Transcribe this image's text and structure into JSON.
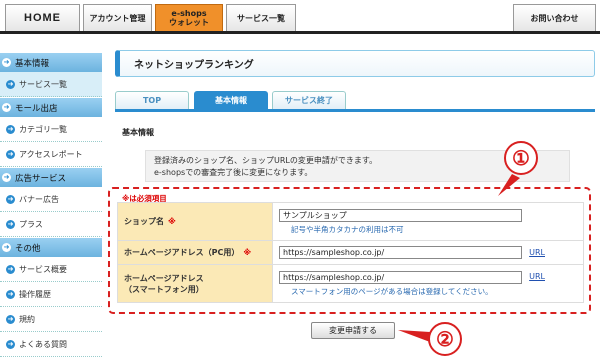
{
  "nav": {
    "home": "HOME",
    "account": "アカウント管理",
    "eshops_line1": "e-shops",
    "eshops_line2": "ウォレット",
    "services": "サービス一覧",
    "inquiry": "お問い合わせ"
  },
  "sidebar": {
    "sections": [
      {
        "header": "基本情報",
        "items": [
          {
            "label": "サービス一覧",
            "active": true
          }
        ]
      },
      {
        "header": "モール出店",
        "items": [
          {
            "label": "カテゴリ一覧"
          },
          {
            "label": "アクセスレポート"
          }
        ]
      },
      {
        "header": "広告サービス",
        "items": [
          {
            "label": "バナー広告"
          },
          {
            "label": "プラス"
          }
        ]
      },
      {
        "header": "その他",
        "items": [
          {
            "label": "サービス概要"
          },
          {
            "label": "操作履歴"
          },
          {
            "label": "規約"
          },
          {
            "label": "よくある質問"
          }
        ]
      }
    ]
  },
  "main": {
    "title": "ネットショップランキング",
    "tabs": [
      "TOP",
      "基本情報",
      "サービス終了"
    ],
    "active_tab": 1,
    "section_label": "基本情報",
    "notice_line1": "登録済みのショップ名、ショップURLの変更申請ができます。",
    "notice_line2": "e-shopsでの審査完了後に変更になります。",
    "required_note": "※は必須項目",
    "form": {
      "shop_name_label": "ショップ名",
      "shop_name_required": "※",
      "shop_name_value": "サンプルショップ",
      "shop_name_hint": "記号や半角カタカナの利用は不可",
      "pc_label": "ホームページアドレス（PC用）",
      "pc_required": "※",
      "pc_value": "https://sampleshop.co.jp/",
      "pc_url_link": "URL",
      "sp_label_line1": "ホームページアドレス",
      "sp_label_line2": "（スマートフォン用）",
      "sp_value": "https://sampleshop.co.jp/",
      "sp_url_link": "URL",
      "sp_hint": "スマートフォン用のページがある場合は登録してください。"
    },
    "submit_label": "変更申請する"
  },
  "annotations": {
    "callout1": "①",
    "callout2": "②",
    "color": "#d82020"
  }
}
